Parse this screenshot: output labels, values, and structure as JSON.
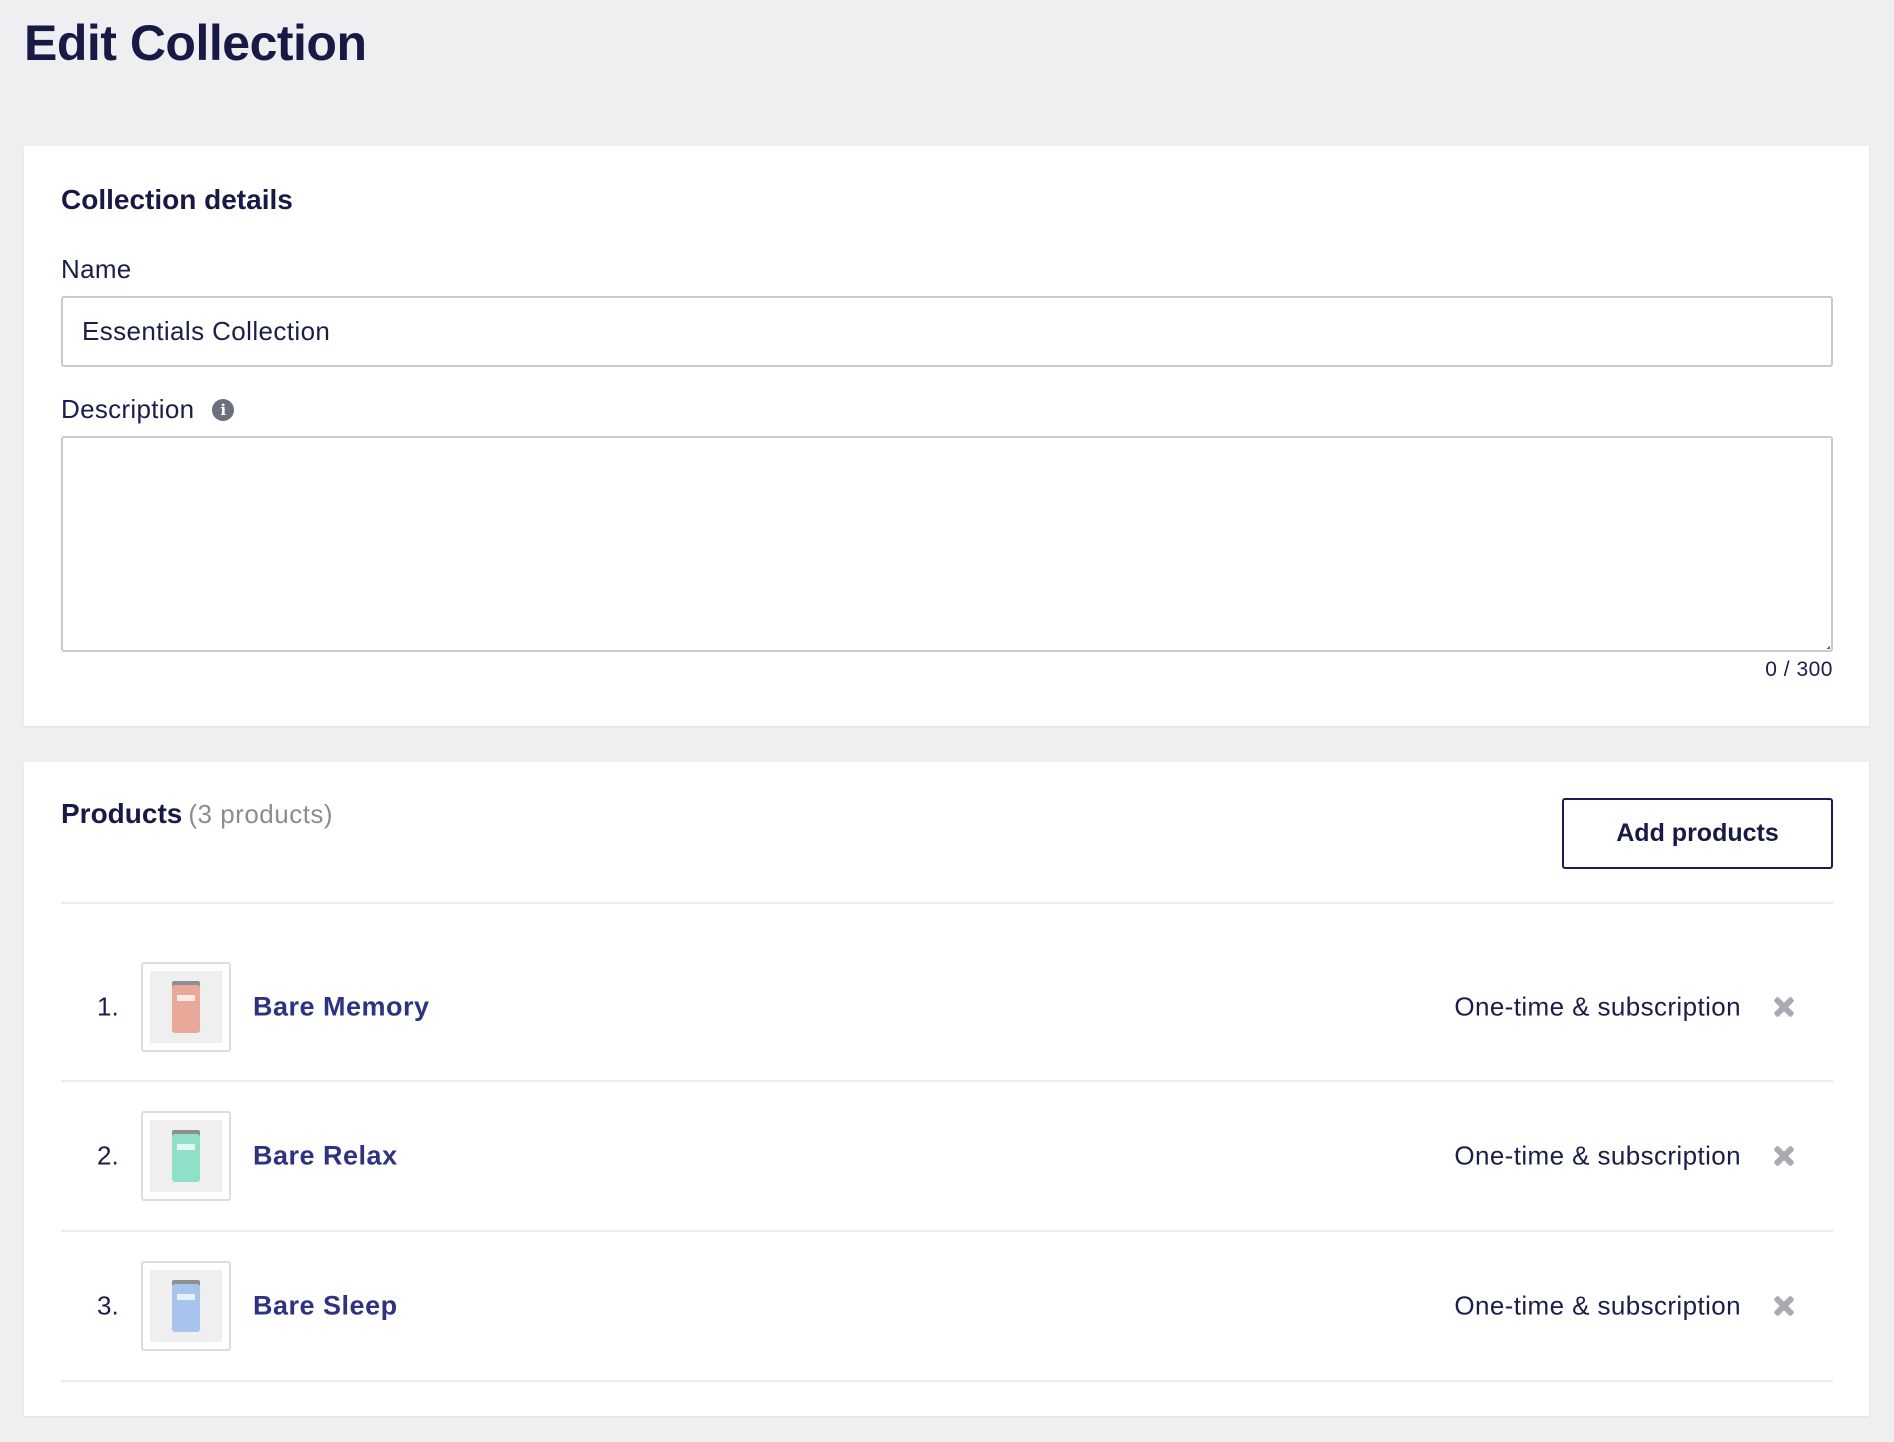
{
  "page": {
    "title": "Edit Collection"
  },
  "details": {
    "section_title": "Collection details",
    "name_label": "Name",
    "name_value": "Essentials Collection",
    "description_label": "Description",
    "description_value": "",
    "char_count": "0 / 300",
    "info_icon": "info-icon"
  },
  "products": {
    "title": "Products",
    "count_text": "(3 products)",
    "add_button_label": "Add products",
    "items": [
      {
        "index": "1.",
        "name": "Bare Memory",
        "purchase_type": "One-time & subscription",
        "jar_color": "#e9a99a"
      },
      {
        "index": "2.",
        "name": "Bare Relax",
        "purchase_type": "One-time & subscription",
        "jar_color": "#8fe0c9"
      },
      {
        "index": "3.",
        "name": "Bare Sleep",
        "purchase_type": "One-time & subscription",
        "jar_color": "#a9c4ec"
      }
    ]
  },
  "colors": {
    "background": "#efeff1",
    "heading": "#181a45",
    "link": "#2e3381",
    "muted": "#8a8c96"
  }
}
